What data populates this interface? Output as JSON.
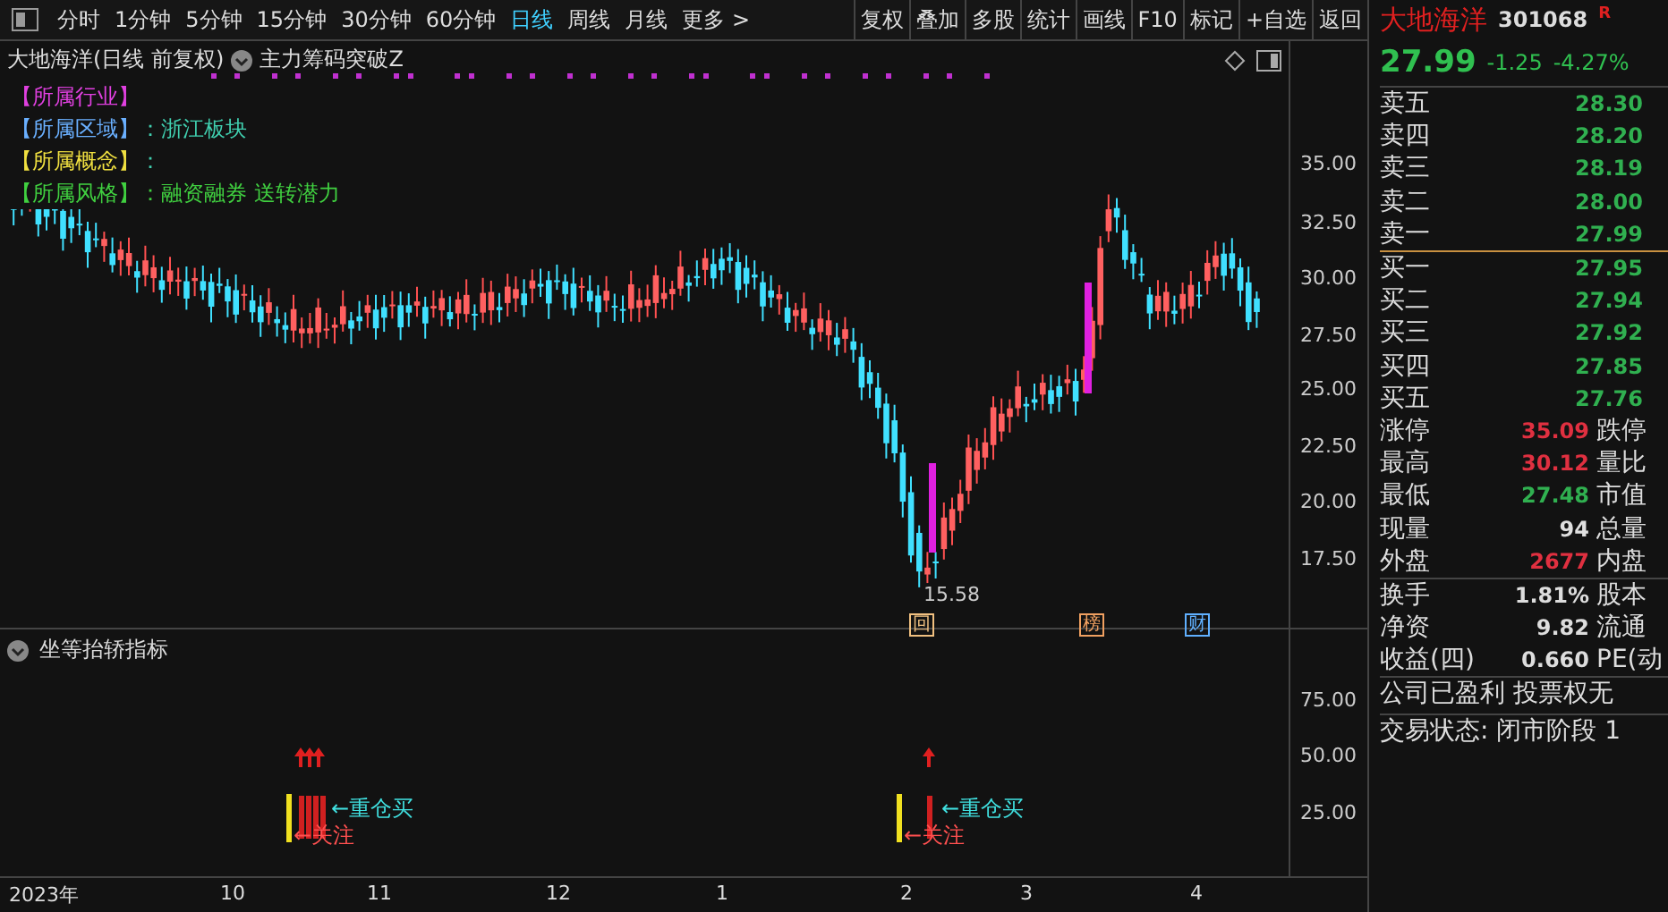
{
  "toolbar": {
    "periods": [
      {
        "label": "分时",
        "selected": false
      },
      {
        "label": "1分钟",
        "selected": false
      },
      {
        "label": "5分钟",
        "selected": false
      },
      {
        "label": "15分钟",
        "selected": false
      },
      {
        "label": "30分钟",
        "selected": false
      },
      {
        "label": "60分钟",
        "selected": false
      },
      {
        "label": "日线",
        "selected": true
      },
      {
        "label": "周线",
        "selected": false
      },
      {
        "label": "月线",
        "selected": false
      },
      {
        "label": "更多 >",
        "selected": false
      }
    ],
    "buttons": [
      "复权",
      "叠加",
      "多股",
      "统计",
      "画线",
      "F10",
      "标记",
      "+自选",
      "返回"
    ]
  },
  "main_chart": {
    "title": "大地海洋(日线 前复权)",
    "indicator": "主力筹码突破Z",
    "info": [
      {
        "tag": "【所属行业】",
        "color": "#e040e0"
      },
      {
        "tag": "【所属区域】",
        "color": "#6ab0ff",
        "text": "：浙江板块"
      },
      {
        "tag": "【所属概念】",
        "color": "#f0e040",
        "text": "："
      },
      {
        "tag": "【所属风格】",
        "color": "#40d040",
        "text": "：融资融券 送转潜力"
      }
    ],
    "y_axis": [
      "35.00",
      "32.50",
      "30.00",
      "27.50",
      "25.00",
      "22.50",
      "20.00",
      "17.50"
    ],
    "low_label": "15.58",
    "markers": [
      {
        "text": "回",
        "color": "#f0c080"
      },
      {
        "text": "榜",
        "color": "#f0a060"
      },
      {
        "text": "财",
        "color": "#60b0ff"
      }
    ]
  },
  "indicator_panel": {
    "title": "坐等抬轿指标",
    "y_axis": [
      "75.00",
      "50.00",
      "25.00"
    ],
    "signals": [
      {
        "buy": "←重仓买",
        "watch": "←关注"
      },
      {
        "buy": "←重仓买",
        "watch": "←关注"
      }
    ]
  },
  "x_axis": [
    "2023年",
    "10",
    "11",
    "12",
    "1",
    "2",
    "3",
    "4"
  ],
  "quote": {
    "name": "大地海洋",
    "code": "301068",
    "badge": "R",
    "price": "27.99",
    "change": "-1.25",
    "change_pct": "-4.27%",
    "asks": [
      {
        "label": "卖五",
        "price": "28.30"
      },
      {
        "label": "卖四",
        "price": "28.20"
      },
      {
        "label": "卖三",
        "price": "28.19"
      },
      {
        "label": "卖二",
        "price": "28.00"
      },
      {
        "label": "卖一",
        "price": "27.99"
      }
    ],
    "bids": [
      {
        "label": "买一",
        "price": "27.95"
      },
      {
        "label": "买二",
        "price": "27.94"
      },
      {
        "label": "买三",
        "price": "27.92"
      },
      {
        "label": "买四",
        "price": "27.85"
      },
      {
        "label": "买五",
        "price": "27.76"
      }
    ],
    "stats": [
      {
        "label": "涨停",
        "value": "35.09",
        "color": "#e03040",
        "label_2": "跌停"
      },
      {
        "label": "最高",
        "value": "30.12",
        "color": "#e03040",
        "label_2": "量比"
      },
      {
        "label": "最低",
        "value": "27.48",
        "color": "#30b050",
        "label_2": "市值"
      },
      {
        "label": "现量",
        "value": "94",
        "color": "#e0e0e0",
        "label_2": "总量"
      },
      {
        "label": "外盘",
        "value": "2677",
        "color": "#e03040",
        "label_2": "内盘"
      }
    ],
    "stats_2": [
      {
        "label": "换手",
        "value": "1.81%",
        "label_2": "股本"
      },
      {
        "label": "净资",
        "value": "9.82",
        "label_2": "流通"
      },
      {
        "label": "收益(四)",
        "value": "0.660",
        "label_2": "PE(动"
      }
    ],
    "notes": [
      "公司已盈利 投票权无",
      "交易状态: 闭市阶段 1"
    ]
  }
}
